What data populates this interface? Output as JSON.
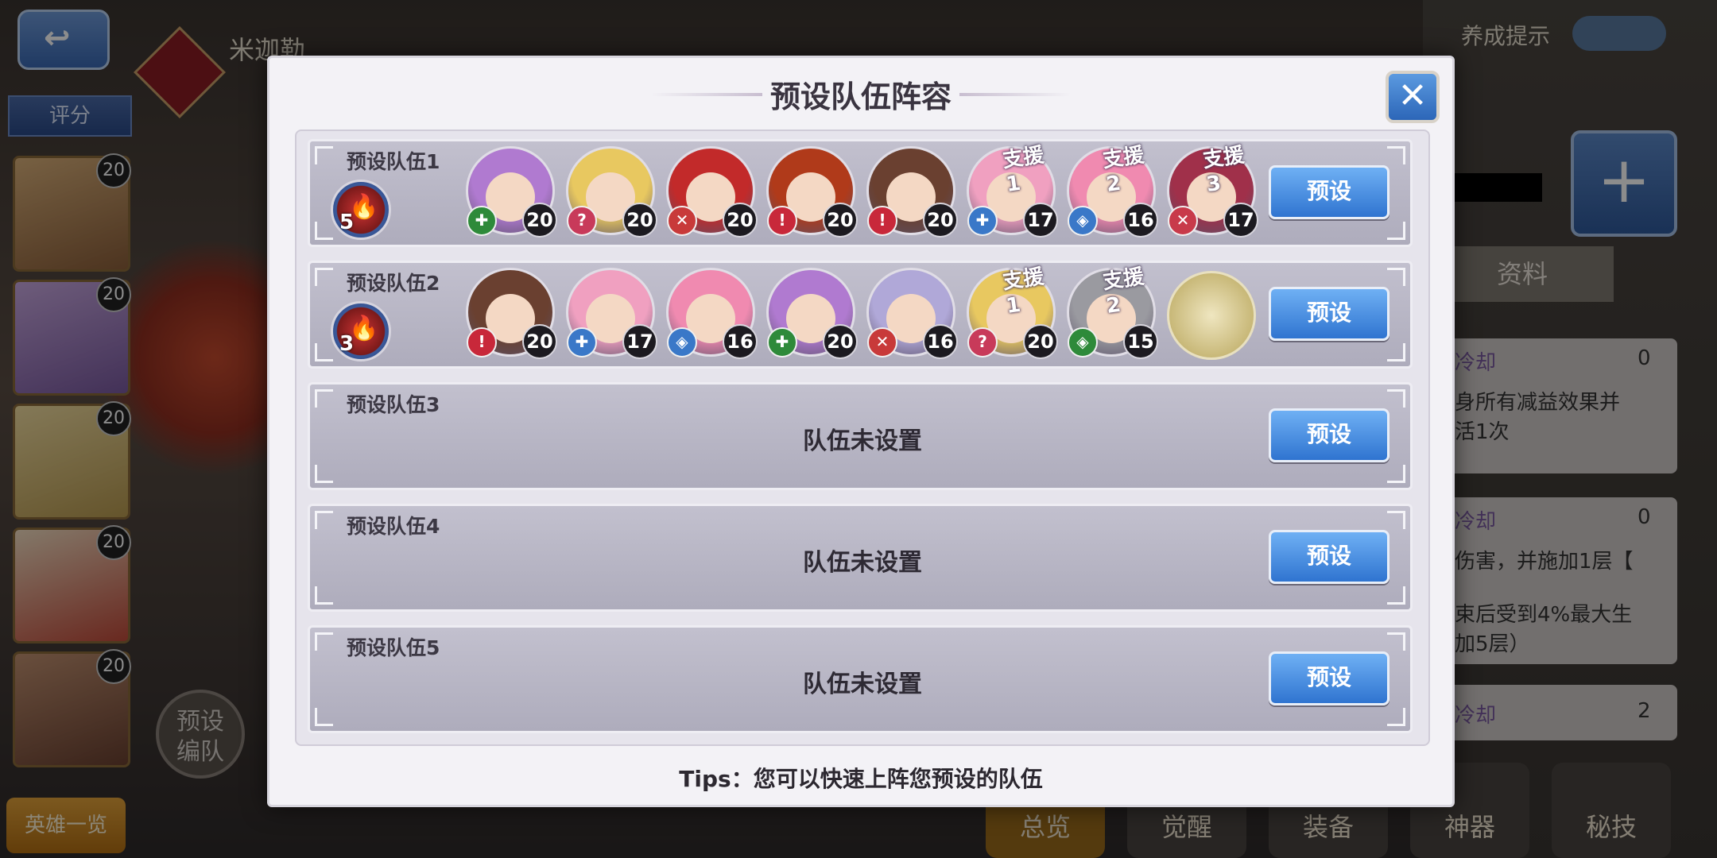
{
  "background": {
    "hero_name": "米迦勒",
    "score_tab": "评分",
    "hero_list_button": "英雄一览",
    "preset_team_button": "预设\n编队",
    "training_hint": "养成提示",
    "profile_tab": "资料",
    "side_texts": [
      "身所有减益效果并\n活1次",
      "伤害，并施加1层【\n\n束后受到4%最大生\n加5层）"
    ],
    "cooldown_labels": [
      "冷却",
      "冷却",
      "冷却"
    ],
    "cooldown_values": [
      "0",
      "0",
      "2"
    ],
    "bottom_tabs": [
      "总览",
      "觉醒",
      "装备",
      "神器",
      "秘技"
    ],
    "hero_levels": [
      "20",
      "20",
      "20",
      "20",
      "20"
    ]
  },
  "modal": {
    "title": "预设队伍阵容",
    "close_label": "✕",
    "tips": "Tips：您可以快速上阵您预设的队伍",
    "rows": [
      {
        "title": "预设队伍1",
        "element_level": "5",
        "button": "预设",
        "empty_text": "",
        "members": [
          {
            "level": "20",
            "class": "✚",
            "class_color": "#2e8a3a",
            "hair": "#b07ad0",
            "support": ""
          },
          {
            "level": "20",
            "class": "?",
            "class_color": "#c83a5a",
            "hair": "#e8c860",
            "support": ""
          },
          {
            "level": "20",
            "class": "✕",
            "class_color": "#c83a3a",
            "hair": "#c22a2a",
            "support": ""
          },
          {
            "level": "20",
            "class": "!",
            "class_color": "#c8283a",
            "hair": "#b03a1a",
            "support": ""
          },
          {
            "level": "20",
            "class": "!",
            "class_color": "#c8283a",
            "hair": "#6a4030",
            "support": ""
          },
          {
            "level": "17",
            "class": "✚",
            "class_color": "#3a78c8",
            "hair": "#f0a0c0",
            "support": "支援1"
          },
          {
            "level": "16",
            "class": "◈",
            "class_color": "#3a78c8",
            "hair": "#f08ab0",
            "support": "支援2"
          },
          {
            "level": "17",
            "class": "✕",
            "class_color": "#c83a4a",
            "hair": "#a0304a",
            "support": "支援3"
          }
        ]
      },
      {
        "title": "预设队伍2",
        "element_level": "3",
        "button": "预设",
        "empty_text": "",
        "members": [
          {
            "level": "20",
            "class": "!",
            "class_color": "#c8283a",
            "hair": "#6a4030",
            "support": ""
          },
          {
            "level": "17",
            "class": "✚",
            "class_color": "#3a78c8",
            "hair": "#f0a0c0",
            "support": ""
          },
          {
            "level": "16",
            "class": "◈",
            "class_color": "#3a78c8",
            "hair": "#f08ab0",
            "support": ""
          },
          {
            "level": "20",
            "class": "✚",
            "class_color": "#2e8a3a",
            "hair": "#b07ad0",
            "support": ""
          },
          {
            "level": "16",
            "class": "✕",
            "class_color": "#c83a3a",
            "hair": "#b0a8d8",
            "support": ""
          },
          {
            "level": "20",
            "class": "?",
            "class_color": "#c83a5a",
            "hair": "#e8c860",
            "support": "支援1"
          },
          {
            "level": "15",
            "class": "◈",
            "class_color": "#2e8a3a",
            "hair": "#9a9aa0",
            "support": "支援2"
          }
        ]
      },
      {
        "title": "预设队伍3",
        "element_level": "",
        "button": "预设",
        "empty_text": "队伍未设置",
        "members": []
      },
      {
        "title": "预设队伍4",
        "element_level": "",
        "button": "预设",
        "empty_text": "队伍未设置",
        "members": []
      },
      {
        "title": "预设队伍5",
        "element_level": "",
        "button": "预设",
        "empty_text": "队伍未设置",
        "members": []
      }
    ]
  }
}
